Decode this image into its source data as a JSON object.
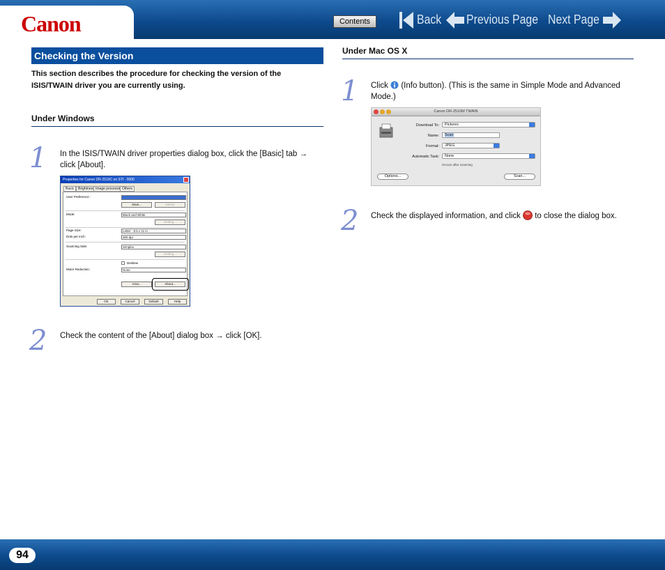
{
  "header": {
    "logo": "Canon",
    "contents_label": "Contents",
    "back_label": "Back",
    "previous_label": "Previous Page",
    "next_label": "Next Page"
  },
  "left": {
    "section_title": "Checking the Version",
    "intro": "This section describes the procedure for checking the version of the ISIS/TWAIN driver you are currently using.",
    "subhead": "Under Windows",
    "steps": [
      {
        "num": "1",
        "text": "In the ISIS/TWAIN driver properties dialog box, click the [Basic] tab → click [About]."
      },
      {
        "num": "2",
        "text": "Check the content of the [About] dialog box → click [OK]."
      }
    ]
  },
  "win_dialog": {
    "title": "Properties for Canon DR-2510C on STI - 0000",
    "tabs": [
      "Basic",
      "Brightness",
      "Image processing",
      "Others"
    ],
    "labels": {
      "user_pref": "User Preference :",
      "mode": "Mode:",
      "page_size": "Page Size:",
      "dpi": "Dots per inch:",
      "scanning_side": "Scanning Side:",
      "moire": "Moire Reduction:",
      "deskew": "Deskew"
    },
    "values": {
      "mode": "Black and White",
      "page_size": "Letter - 8.5 x 11 in",
      "dpi": "300 dpi",
      "scanning_side": "Simplex",
      "moire": "None"
    },
    "buttons": {
      "save": "Save...",
      "delete": "Delete",
      "setting": "Setting...",
      "area": "Area...",
      "about": "About...",
      "ok": "OK",
      "cancel": "Cancel",
      "default": "Default",
      "help": "Help"
    }
  },
  "right": {
    "subhead": "Under Mac OS X",
    "steps": [
      {
        "num": "1",
        "pre": "Click",
        "post": "(Info button). (This is the same in Simple Mode and Advanced Mode.)"
      },
      {
        "num": "2",
        "pre": "Check the displayed information, and click",
        "post": "to close the dialog box."
      }
    ]
  },
  "mac_dialog": {
    "title": "Canon DR-2510M TWAIN",
    "labels": {
      "download": "Download To:",
      "name": "Name:",
      "format": "Format:",
      "task": "Automatic Task:"
    },
    "values": {
      "download": "Pictures",
      "name": "Scan",
      "format": "JPEG",
      "task": "None",
      "task_note": "Occurs after scanning"
    },
    "buttons": {
      "options": "Options...",
      "scan": "Scan..."
    }
  },
  "footer": {
    "page_number": "94"
  },
  "colors": {
    "header_blue": "#0d4a8c",
    "section_blue": "#0a4f9e",
    "step_purple": "#7d8fd1",
    "logo_red": "#cc0000"
  }
}
